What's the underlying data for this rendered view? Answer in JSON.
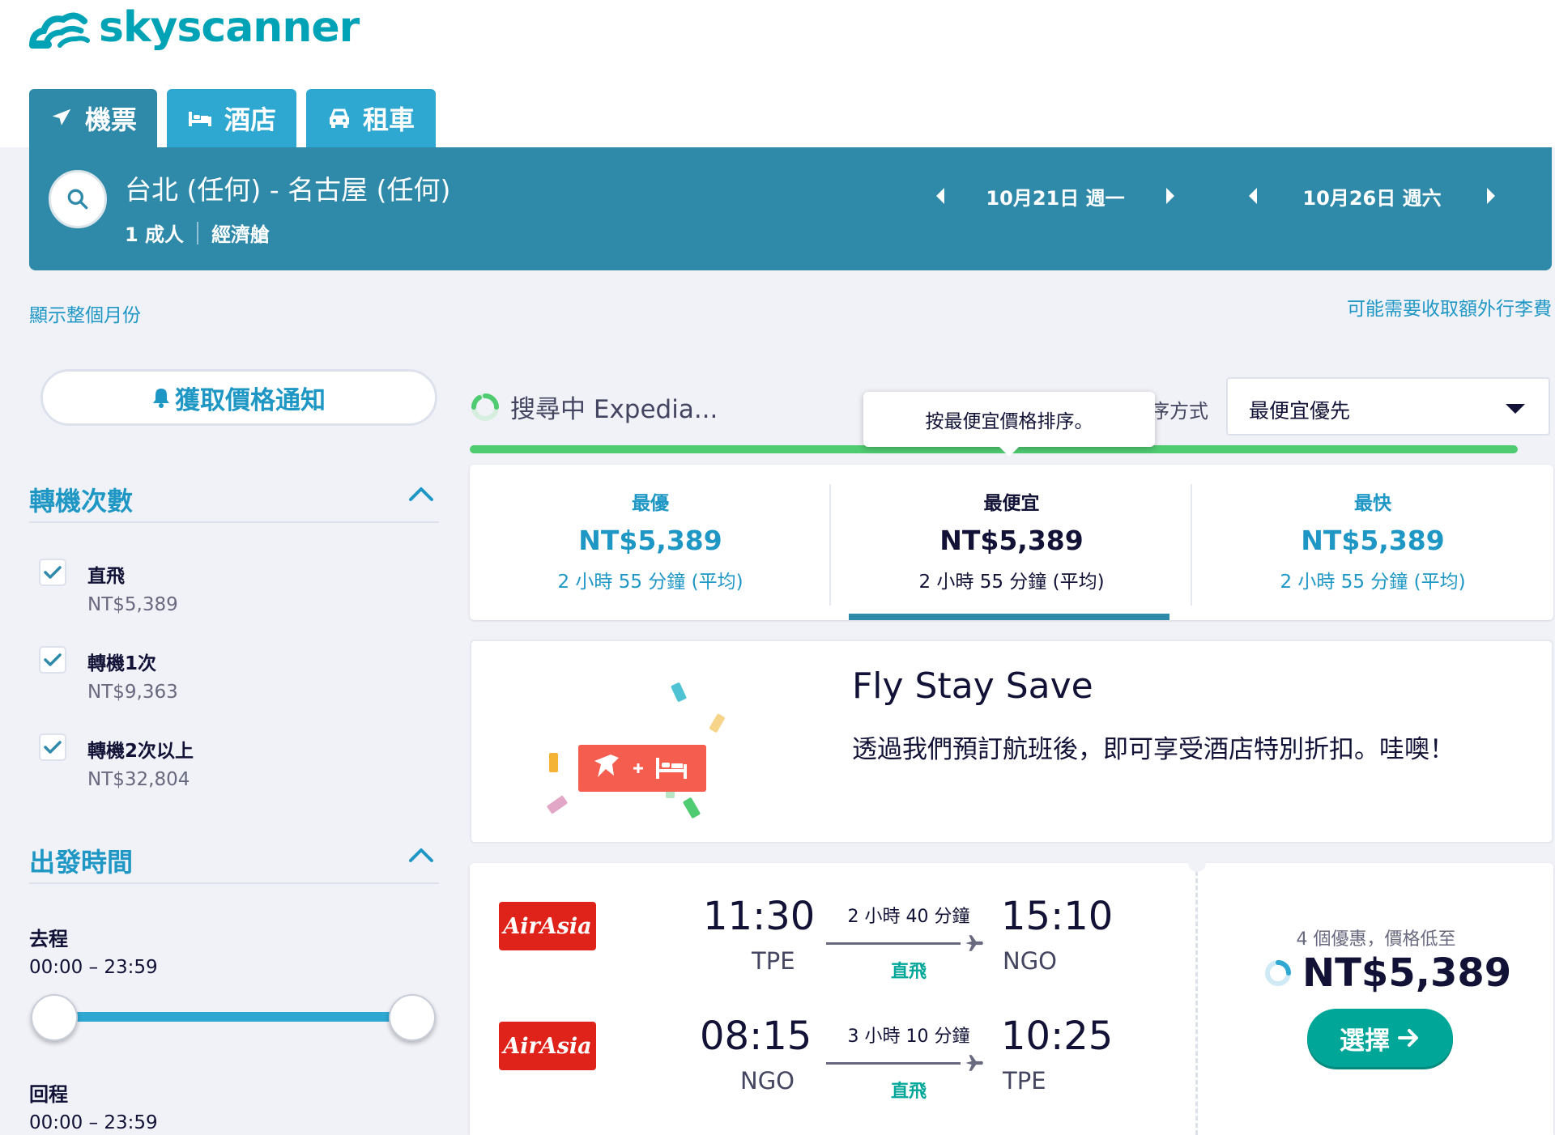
{
  "brand": {
    "name": "skyscanner",
    "color": "#00a2b5"
  },
  "tabs": [
    {
      "label": "機票",
      "icon": "plane-icon"
    },
    {
      "label": "酒店",
      "icon": "bed-icon"
    },
    {
      "label": "租車",
      "icon": "car-icon"
    }
  ],
  "search": {
    "route": "台北 (任何) - 名古屋 (任何)",
    "passengers": "1 成人",
    "cabin": "經濟艙",
    "depart_date": "10月21日 週一",
    "return_date": "10月26日 週六"
  },
  "links": {
    "show_month": "顯示整個月份",
    "baggage_fee": "可能需要收取額外行李費"
  },
  "alert_button": "獲取價格通知",
  "filters": {
    "stops": {
      "title": "轉機次數",
      "items": [
        {
          "label": "直飛",
          "price": "NT$5,389",
          "checked": true
        },
        {
          "label": "轉機1次",
          "price": "NT$9,363",
          "checked": true
        },
        {
          "label": "轉機2次以上",
          "price": "NT$32,804",
          "checked": true
        }
      ]
    },
    "times": {
      "title": "出發時間",
      "outbound_label": "去程",
      "outbound_range": "00:00 – 23:59",
      "return_label": "回程",
      "return_range": "00:00 – 23:59"
    }
  },
  "progress": {
    "text": "搜尋中 Expedia...",
    "percent": 100
  },
  "sort": {
    "label": "排序方式",
    "visible_label": "序方式",
    "selected": "最便宜優先",
    "tooltip": "按最便宜價格排序。"
  },
  "sort_tabs": [
    {
      "title": "最優",
      "price": "NT$5,389",
      "duration": "2 小時 55 分鐘 (平均)"
    },
    {
      "title": "最便宜",
      "price": "NT$5,389",
      "duration": "2 小時 55 分鐘 (平均)"
    },
    {
      "title": "最快",
      "price": "NT$5,389",
      "duration": "2 小時 55 分鐘 (平均)"
    }
  ],
  "promo": {
    "title": "Fly Stay Save",
    "text": "透過我們預訂航班後，即可享受酒店特別折扣。哇噢！"
  },
  "result": {
    "airline": "AirAsia",
    "legs": [
      {
        "dep_time": "11:30",
        "dep_code": "TPE",
        "duration": "2 小時 40 分鐘",
        "stops": "直飛",
        "arr_time": "15:10",
        "arr_code": "NGO"
      },
      {
        "dep_time": "08:15",
        "dep_code": "NGO",
        "duration": "3 小時 10 分鐘",
        "stops": "直飛",
        "arr_time": "10:25",
        "arr_code": "TPE"
      }
    ],
    "deals": "4 個優惠，價格低至",
    "price": "NT$5,389",
    "select_label": "選擇"
  },
  "colors": {
    "primary_dark": "#2f8aa9",
    "primary_light": "#2ea7d1",
    "link_blue": "#1e97c5",
    "green": "#00a698",
    "progress_green": "#4fcb71",
    "promo_red": "#f55d4f"
  }
}
